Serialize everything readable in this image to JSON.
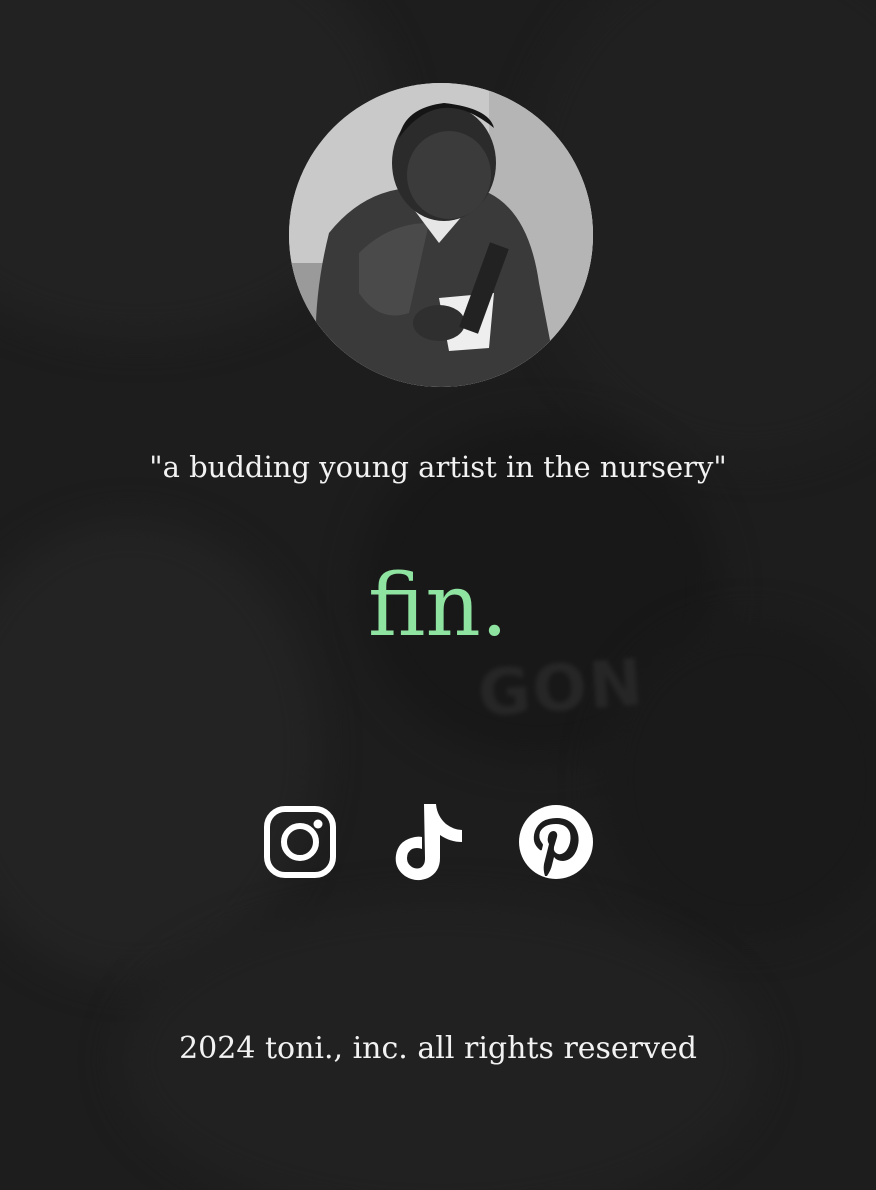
{
  "profile": {
    "avatar_icon": "child-photo-avatar"
  },
  "caption": "\"a budding young artist in the nursery\"",
  "closing": {
    "text": "fin.",
    "color": "#8fe3a1"
  },
  "socials": [
    {
      "icon": "instagram-icon"
    },
    {
      "icon": "tiktok-icon"
    },
    {
      "icon": "pinterest-icon"
    }
  ],
  "footer": {
    "text": "2024 toni., inc. all rights reserved"
  },
  "theme": {
    "background": "#1d1d1d",
    "text": "#f2f2f2",
    "accent": "#8fe3a1"
  }
}
